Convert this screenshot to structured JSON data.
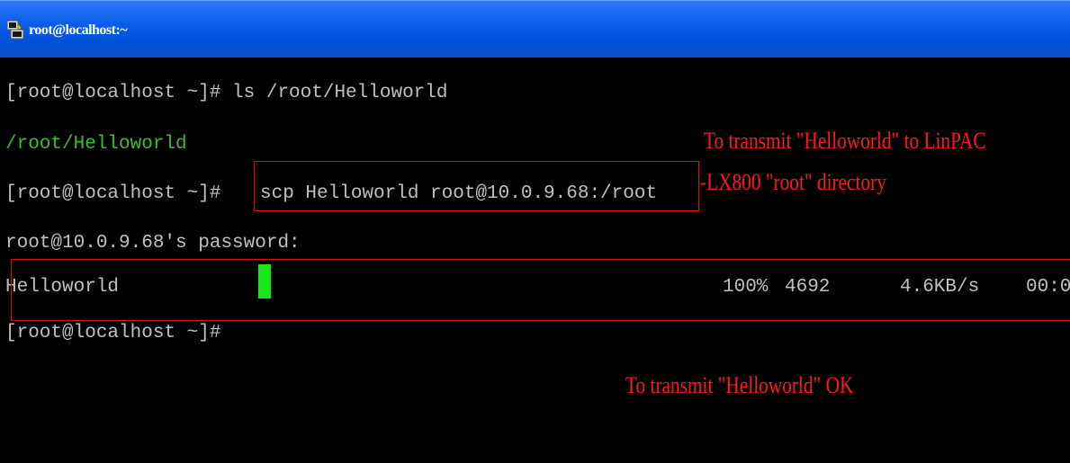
{
  "window": {
    "title": "root@localhost:~",
    "icon": "putty-terminal-icon"
  },
  "terminal": {
    "lines": [
      "[root@localhost ~]# ls /root/Helloworld",
      "/root/Helloworld",
      "[root@localhost ~]# ",
      "root@10.0.9.68's password:",
      "[root@localhost ~]# "
    ],
    "scp_command": "scp Helloworld root@10.0.9.68:/root",
    "transfer": {
      "filename": "Helloworld",
      "percent": "100%",
      "size": "4692",
      "rate": "4.6KB/s",
      "eta": "00:0"
    }
  },
  "annotations": {
    "scp_note_line1": "To transmit \"Helloworld\" to LinPAC",
    "scp_note_line2": "-LX800 \"root\" directory",
    "ok_note": "To transmit \"Helloworld\" OK"
  },
  "colors": {
    "background": "#000000",
    "text": "#c0c0c0",
    "directory": "#3bbd2c",
    "cursor": "#18e818",
    "annotation": "#ff1a1a",
    "titlebar": "#0b5fe8"
  }
}
